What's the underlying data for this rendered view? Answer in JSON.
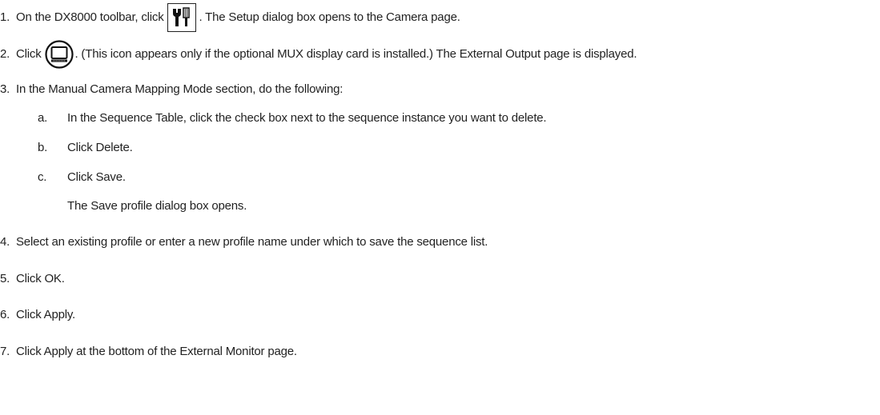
{
  "steps": [
    {
      "num": "1.",
      "before": "On the DX8000 toolbar, click",
      "after": ". The Setup dialog box opens to the Camera page."
    },
    {
      "num": "2.",
      "before": "Click",
      "after": ". (This icon appears only if the optional MUX display card is installed.) The External Output page is displayed."
    },
    {
      "num": "3.",
      "text": "In the Manual Camera Mapping Mode section, do the following:"
    },
    {
      "num": "4.",
      "text": "Select an existing profile or enter a new profile name under which to save the sequence list."
    },
    {
      "num": "5.",
      "text": "Click OK."
    },
    {
      "num": "6.",
      "text": "Click Apply."
    },
    {
      "num": "7.",
      "text": "Click Apply at the bottom of the External Monitor page."
    }
  ],
  "substeps": [
    {
      "letter": "a.",
      "text": "In the Sequence Table, click the check box next to the sequence instance you want to delete."
    },
    {
      "letter": "b.",
      "text": "Click Delete."
    },
    {
      "letter": "c.",
      "text": "Click Save."
    }
  ],
  "substep_note": "The Save profile dialog box opens.",
  "icons": {
    "step1": "tools-icon",
    "step2": "monitor-icon"
  }
}
